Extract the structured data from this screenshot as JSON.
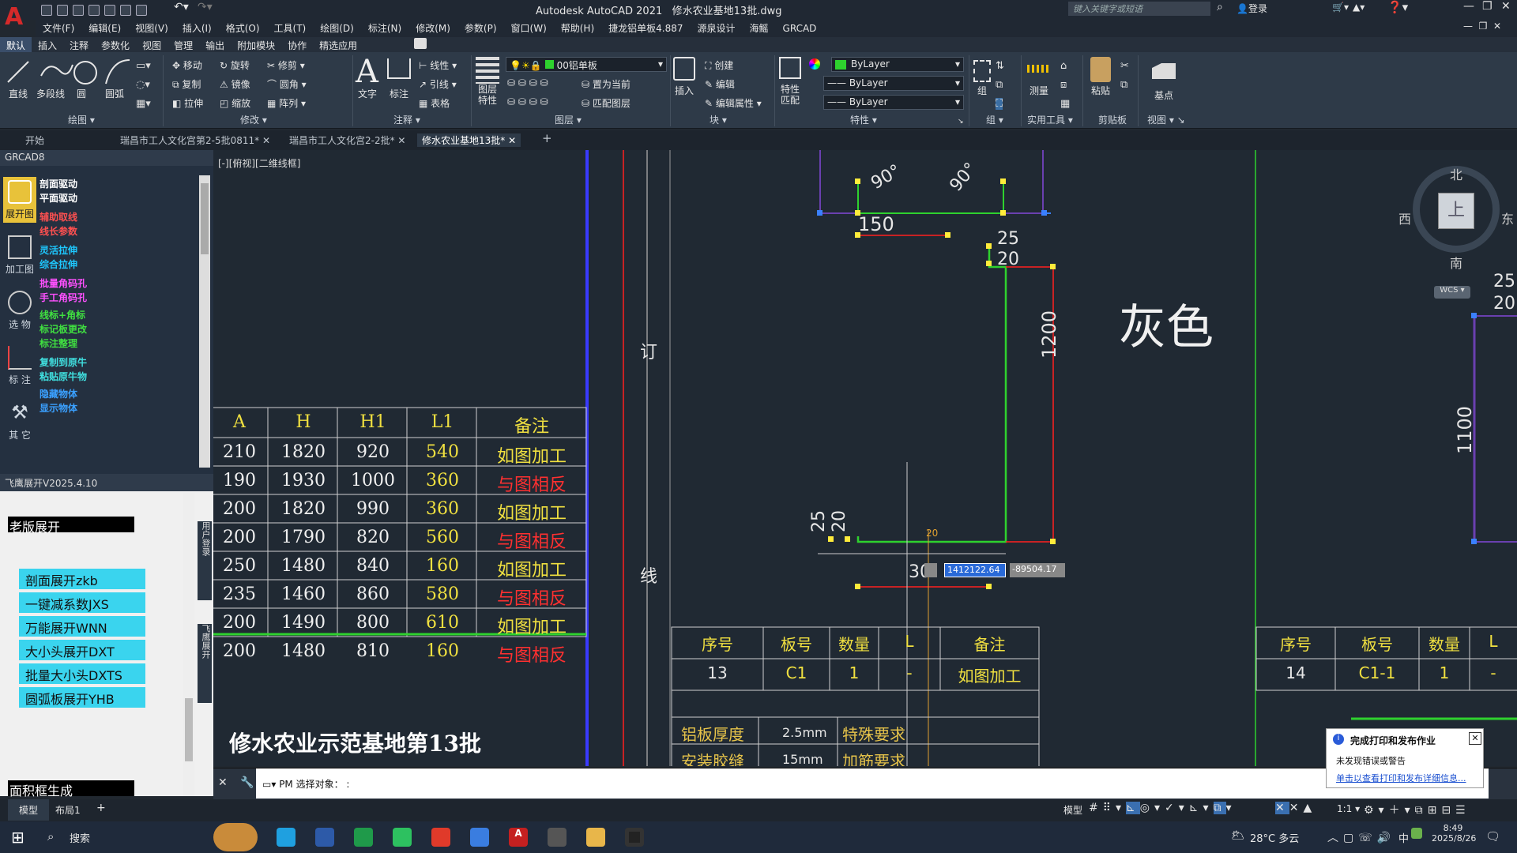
{
  "app": {
    "title": "Autodesk AutoCAD 2021",
    "file": "修水农业基地13批.dwg",
    "search_placeholder": "键入关键字或短语",
    "login": "登录"
  },
  "menu": [
    "文件(F)",
    "编辑(E)",
    "视图(V)",
    "插入(I)",
    "格式(O)",
    "工具(T)",
    "绘图(D)",
    "标注(N)",
    "修改(M)",
    "参数(P)",
    "窗口(W)",
    "帮助(H)",
    "捷龙铝单板4.887",
    "源泉设计",
    "海鳐",
    "GRCAD"
  ],
  "ribbon_tabs": [
    "默认",
    "插入",
    "注释",
    "参数化",
    "视图",
    "管理",
    "输出",
    "附加模块",
    "协作",
    "精选应用"
  ],
  "ribbon": {
    "draw": {
      "title": "绘图",
      "line": "直线",
      "polyline": "多段线",
      "circle": "圆",
      "arc": "圆弧"
    },
    "modify": {
      "title": "修改",
      "move": "移动",
      "rotate": "旋转",
      "trim": "修剪",
      "copy": "复制",
      "mirror": "镜像",
      "fillet": "圆角",
      "stretch": "拉伸",
      "scale": "缩放",
      "array": "阵列"
    },
    "annot": {
      "title": "注释",
      "text": "文字",
      "dim": "标注",
      "linear": "线性",
      "leader": "引线",
      "table": "表格"
    },
    "layers": {
      "title": "图层",
      "props": "图层特性",
      "current": "00铝单板",
      "make_current": "置为当前",
      "match": "匹配图层"
    },
    "block": {
      "title": "块",
      "insert": "插入",
      "create": "创建",
      "edit": "编辑",
      "edit_attr": "编辑属性"
    },
    "props": {
      "title": "特性",
      "match": "特性匹配",
      "color": "ByLayer",
      "linetype": "ByLayer",
      "lineweight": "ByLayer"
    },
    "group": {
      "title": "组",
      "group": "组"
    },
    "util": {
      "title": "实用工具",
      "measure": "测量"
    },
    "clip": {
      "title": "剪贴板",
      "paste": "粘贴"
    },
    "view": {
      "title": "视图",
      "base": "基点"
    }
  },
  "doc_tabs": [
    "开始",
    "瑞昌市工人文化宫第2-5批0811*",
    "瑞昌市工人文化宫2-2批*",
    "修水农业基地13批*"
  ],
  "viewport_label": "[-][俯视][二维线框]",
  "grcad": {
    "title": "GRCAD8",
    "icons": [
      "展开图",
      "加工图",
      "选 物",
      "标 注",
      "其 它"
    ],
    "links": [
      {
        "t": "剖面驱动",
        "c": "#ffffff"
      },
      {
        "t": "平面驱动",
        "c": "#ffffff"
      },
      {
        "t": "辅助取线",
        "c": "#ff5050"
      },
      {
        "t": "线长参数",
        "c": "#ff5050"
      },
      {
        "t": "灵活拉伸",
        "c": "#1ec8ff"
      },
      {
        "t": "综合拉伸",
        "c": "#1ec8ff"
      },
      {
        "t": "批量角码孔",
        "c": "#ff50ff"
      },
      {
        "t": "手工角码孔",
        "c": "#ff50ff"
      },
      {
        "t": "线标+角标",
        "c": "#40e040"
      },
      {
        "t": "标记板更改",
        "c": "#40e040"
      },
      {
        "t": "标注整理",
        "c": "#40e040"
      },
      {
        "t": "复制到原牛",
        "c": "#40e0e0"
      },
      {
        "t": "粘贴原牛物",
        "c": "#40e0e0"
      },
      {
        "t": "隐藏物体",
        "c": "#3aa0ff"
      },
      {
        "t": "显示物体",
        "c": "#3aa0ff"
      }
    ]
  },
  "feiying": {
    "title": "飞鹰展开V2025.4.10",
    "old": "老版展开",
    "buttons": [
      "剖面展开zkb",
      "一键减系数JXS",
      "万能展开WNN",
      "大小头展开DXT",
      "批量大小头DXTS",
      "圆弧板展开YHB"
    ],
    "area": "面积框生成",
    "side1": "用户登录",
    "side2": "飞鹰展开"
  },
  "table": {
    "headers": [
      "A",
      "H",
      "H1",
      "L1",
      "备注"
    ],
    "rows": [
      [
        "210",
        "1820",
        "920",
        "540",
        "如图加工"
      ],
      [
        "190",
        "1930",
        "1000",
        "360",
        "与图相反"
      ],
      [
        "200",
        "1820",
        "990",
        "360",
        "如图加工"
      ],
      [
        "200",
        "1790",
        "820",
        "560",
        "与图相反"
      ],
      [
        "250",
        "1480",
        "840",
        "160",
        "如图加工"
      ],
      [
        "235",
        "1460",
        "860",
        "580",
        "与图相反"
      ],
      [
        "200",
        "1490",
        "800",
        "610",
        "如图加工"
      ],
      [
        "200",
        "1480",
        "810",
        "160",
        "与图相反"
      ]
    ],
    "project": "修水农业示范基地第13批"
  },
  "drawing": {
    "dims": {
      "top150": "150",
      "ang1": "90°",
      "ang2": "90°",
      "d25a": "25",
      "d20a": "20",
      "d1200": "1200",
      "d25b": "25",
      "d20b": "20",
      "d300": "30",
      "d20c": "20",
      "d1100": "1100",
      "r25": "25",
      "r20": "20"
    },
    "color_label": "灰色",
    "ding": "订",
    "xian": "线",
    "coords": {
      "x": "1412122.64",
      "y": "-89504.17"
    },
    "tbl1": {
      "headers": [
        "序号",
        "板号",
        "数量",
        "L",
        "备注"
      ],
      "row": [
        "13",
        "C1",
        "1",
        "-",
        "如图加工"
      ]
    },
    "tbl2": {
      "headers": [
        "序号",
        "板号",
        "数量",
        "L"
      ],
      "row": [
        "14",
        "C1-1",
        "1",
        "-"
      ]
    },
    "thick": {
      "label": "铝板厚度",
      "val": "2.5mm",
      "req": "特殊要求"
    },
    "gap": {
      "label": "安装胶缝",
      "val": "15mm",
      "req": "加筋要求"
    }
  },
  "compass": {
    "n": "北",
    "s": "南",
    "e": "东",
    "w": "西",
    "center": "上",
    "wcs": "WCS"
  },
  "command": {
    "prompt": "PM 选择对象：  :"
  },
  "status": {
    "model_tab": "模型",
    "layout_tab": "布局1",
    "model": "模型",
    "scale": "1:1"
  },
  "notify": {
    "title": "完成打印和发布作业",
    "line1": "未发现错误或警告",
    "link": "单击以查看打印和发布详细信息..."
  },
  "taskbar": {
    "search": "搜索",
    "weather": "28°C 多云",
    "time": "8:49",
    "date": "2025/8/26",
    "ime": "中"
  }
}
